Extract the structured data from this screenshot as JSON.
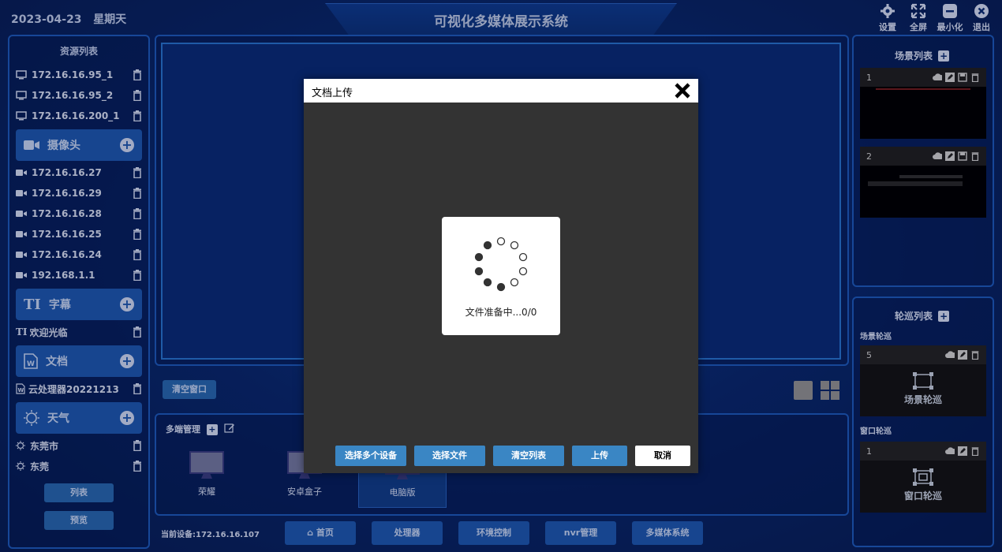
{
  "header": {
    "date": "2023-04-23",
    "weekday": "星期天",
    "title": "可视化多媒体展示系统",
    "buttons": [
      {
        "label": "设置",
        "icon": "gear-icon"
      },
      {
        "label": "全屏",
        "icon": "fullscreen-icon"
      },
      {
        "label": "最小化",
        "icon": "minimize-icon"
      },
      {
        "label": "退出",
        "icon": "exit-icon"
      }
    ]
  },
  "sidebar": {
    "title": "资源列表",
    "displays": [
      "172.16.16.95_1",
      "172.16.16.95_2",
      "172.16.16.200_1"
    ],
    "cameras": {
      "label": "摄像头",
      "items": [
        "172.16.16.27",
        "172.16.16.29",
        "172.16.16.28",
        "172.16.16.25",
        "172.16.16.24",
        "192.168.1.1"
      ]
    },
    "subtitles": {
      "label": "字幕",
      "items": [
        "欢迎光临"
      ]
    },
    "documents": {
      "label": "文档",
      "items": [
        "云处理器20221213"
      ]
    },
    "weather": {
      "label": "天气",
      "items": [
        "东莞市",
        "东莞"
      ]
    },
    "list_button": "列表",
    "preview_button": "预览"
  },
  "center": {
    "clear_window": "清空窗口",
    "multi_title": "多端管理",
    "devices": [
      "荣耀",
      "安卓盒子",
      "电脑版"
    ],
    "current_device": "当前设备:172.16.16.107"
  },
  "nav": [
    "首页",
    "处理器",
    "环境控制",
    "nvr管理",
    "多媒体系统"
  ],
  "right": {
    "scene_title": "场景列表",
    "scenes": [
      {
        "num": "1"
      },
      {
        "num": "2"
      }
    ],
    "tour_title": "轮巡列表",
    "scene_tour_label": "场景轮巡",
    "scene_tour": {
      "num": "5",
      "name": "场景轮巡"
    },
    "window_tour_label": "窗口轮巡",
    "window_tour": {
      "num": "1",
      "name": "窗口轮巡"
    }
  },
  "dialog": {
    "title": "文档上传",
    "loading_text": "文件准备中...0/0",
    "buttons": [
      "选择多个设备",
      "选择文件",
      "清空列表",
      "上传",
      "取消"
    ]
  }
}
